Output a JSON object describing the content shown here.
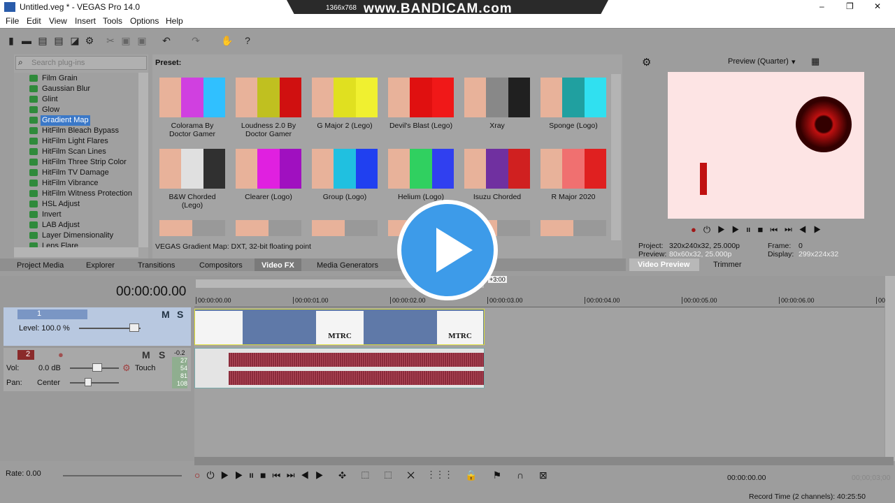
{
  "window": {
    "title": "Untitled.veg * - VEGAS Pro 14.0",
    "controls": [
      "–",
      "❐",
      "✕"
    ]
  },
  "overlay": {
    "resolution": "1366x768",
    "watermark": "www.BANDICAM.com"
  },
  "menu": [
    "File",
    "Edit",
    "View",
    "Insert",
    "Tools",
    "Options",
    "Help"
  ],
  "plugins": {
    "search_placeholder": "Search plug-ins",
    "items": [
      "Film Grain",
      "Gaussian Blur",
      "Glint",
      "Glow",
      "Gradient Map",
      "HitFilm Bleach Bypass",
      "HitFilm Light Flares",
      "HitFilm Scan Lines",
      "HitFilm Three Strip Color",
      "HitFilm TV Damage",
      "HitFilm Vibrance",
      "HitFilm Witness Protection",
      "HSL Adjust",
      "Invert",
      "LAB Adjust",
      "Layer Dimensionality",
      "Lens Flare"
    ],
    "selected": "Gradient Map"
  },
  "presets": {
    "label": "Preset:",
    "items": [
      {
        "name": "Colorama By Doctor Gamer",
        "colors": [
          "#e8b29a",
          "#d040e0",
          "#30c0ff"
        ]
      },
      {
        "name": "Loudness 2.0 By Doctor Gamer",
        "colors": [
          "#e8b29a",
          "#c0c020",
          "#d01010"
        ]
      },
      {
        "name": "G Major 2 (Lego)",
        "colors": [
          "#e8b29a",
          "#e0e020",
          "#f0f030"
        ]
      },
      {
        "name": "Devil's Blast (Lego)",
        "colors": [
          "#e8b29a",
          "#e01010",
          "#f01818"
        ]
      },
      {
        "name": "Xray",
        "colors": [
          "#e8b29a",
          "#888888",
          "#202020"
        ]
      },
      {
        "name": "Sponge (Logo)",
        "colors": [
          "#e8b29a",
          "#20a0a0",
          "#30e0f0"
        ]
      },
      {
        "name": "B&W Chorded (Lego)",
        "colors": [
          "#e8b29a",
          "#e0e0e0",
          "#303030"
        ]
      },
      {
        "name": "Clearer (Logo)",
        "colors": [
          "#e8b29a",
          "#e020e0",
          "#a010c0"
        ]
      },
      {
        "name": "Group (Logo)",
        "colors": [
          "#e8b29a",
          "#20c0e0",
          "#2040f0"
        ]
      },
      {
        "name": "Helium (Logo)",
        "colors": [
          "#e8b29a",
          "#30d060",
          "#3040f0"
        ]
      },
      {
        "name": "Isuzu Chorded",
        "colors": [
          "#e8b29a",
          "#7030a0",
          "#d02020"
        ]
      },
      {
        "name": "R Major 2020",
        "colors": [
          "#e8b29a",
          "#f07070",
          "#e02020"
        ]
      }
    ],
    "status": "VEGAS Gradient Map: DXT, 32-bit floating point"
  },
  "dock_tabs": [
    "Project Media",
    "Explorer",
    "Transitions",
    "Compositors",
    "Video FX",
    "Media Generators"
  ],
  "active_dock_tab": "Video FX",
  "preview": {
    "mode": "Preview (Quarter)",
    "project": "Project:",
    "project_val": "320x240x32, 25.000p",
    "preview": "Preview:",
    "preview_val": "80x60x32, 25.000p",
    "frame": "Frame:",
    "frame_val": "0",
    "display": "Display:",
    "display_val": "299x224x32",
    "tabs": [
      "Video Preview",
      "Trimmer"
    ]
  },
  "timeline": {
    "time": "00:00:00.00",
    "region_len": "+3:00",
    "ruler": [
      "00:00:00.00",
      "00:00:01.00",
      "00:00:02.00",
      "00:00:03.00",
      "00:00:04.00",
      "00:00:05.00",
      "00:00:06.00",
      "00:"
    ],
    "video_track": {
      "num": "1",
      "level": "Level: 100.0 %",
      "m": "M",
      "s": "S",
      "clip_text": [
        "MTRC",
        "MTRC"
      ]
    },
    "audio_track": {
      "num": "2",
      "vol_label": "Vol:",
      "vol": "0.0 dB",
      "pan_label": "Pan:",
      "pan": "Center",
      "mode": "Touch",
      "m": "M",
      "s": "S",
      "meter_top": "-0.2",
      "meter": [
        "27",
        "54",
        "81",
        "108"
      ]
    }
  },
  "bottom": {
    "rate": "Rate: 0.00",
    "cursor_time": "00:00:00.00",
    "end_time": "00;00;03;00",
    "record": "Record Time (2 channels): 40:25:50"
  },
  "accent": "#3a78c8"
}
